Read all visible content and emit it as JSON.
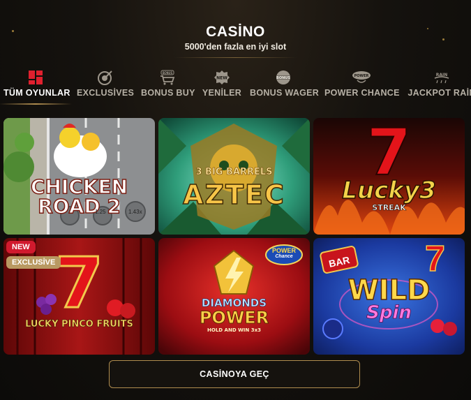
{
  "header": {
    "title": "CASİNO",
    "subtitle": "5000'den fazla en iyi slot"
  },
  "tabs": [
    {
      "label": "TÜM OYUNLAR",
      "icon": "grid-icon",
      "active": true
    },
    {
      "label": "EXCLUSİVES",
      "icon": "target-icon",
      "active": false
    },
    {
      "label": "BONUS BUY",
      "icon": "cart-icon",
      "badge": "BONUS",
      "active": false
    },
    {
      "label": "YENİLER",
      "icon": "new-icon",
      "badge": "NEW",
      "active": false
    },
    {
      "label": "BONUS WAGER",
      "icon": "wager-icon",
      "badge": "BONUS",
      "active": false
    },
    {
      "label": "POWER CHANCE",
      "icon": "power-chance-icon",
      "badge": "POWER",
      "active": false
    },
    {
      "label": "JACKPOT RAİN",
      "icon": "jackpot-rain-icon",
      "badge": "RAIN",
      "active": false
    }
  ],
  "games": [
    {
      "title_line1": "CHICKEN",
      "title_line2": "ROAD 2",
      "multiplier_a": "1.25",
      "multiplier_b": "1.43x"
    },
    {
      "title_line1": "3 BIG BARRELS",
      "title_line2": "AZTEC"
    },
    {
      "title_line1": "Lucky3",
      "title_line2": "STREAK",
      "big_digit": "7"
    },
    {
      "title_line1": "LUCKY PINCO FRUITS",
      "big_digit": "7",
      "badge_new": "NEW",
      "badge_exclusive": "EXCLUSİVE"
    },
    {
      "title_line1": "DIAMONDS",
      "title_line2": "POWER",
      "sub": "HOLD AND WIN 3x3",
      "logo_top": "POWER",
      "logo_bottom": "Chance"
    },
    {
      "title_line1": "WILD",
      "title_line2": "Spin",
      "bar_label": "BAR",
      "big_digit": "7"
    }
  ],
  "cta": {
    "label": "CASİNOYA GEÇ"
  },
  "colors": {
    "accent_gold": "#b08d4f",
    "badge_new": "#d11a2e",
    "badge_exclusive": "#b99962",
    "background": "#0f0d0a"
  }
}
